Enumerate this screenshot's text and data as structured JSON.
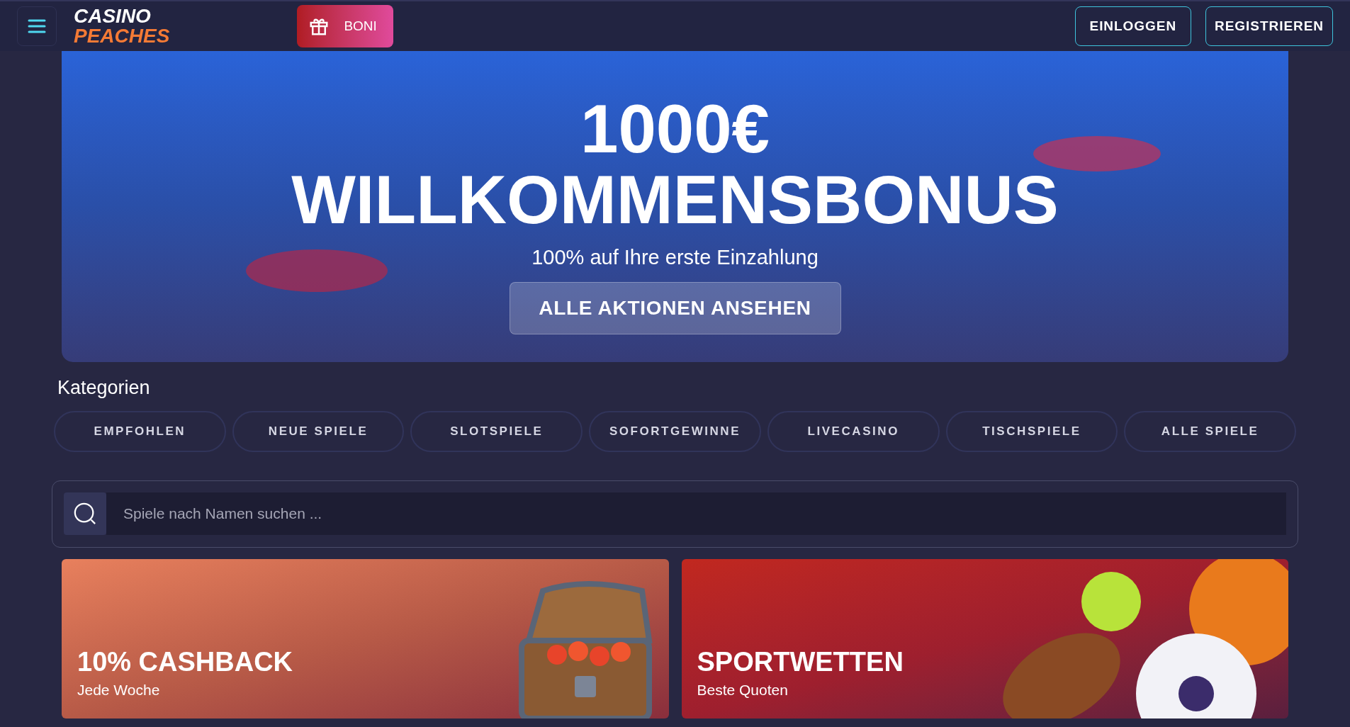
{
  "header": {
    "logo": {
      "line_1": "CASINO",
      "line_2": "PEACHES"
    },
    "bonus_button": "BONI",
    "login_button": "EINLOGGEN",
    "register_button": "REGISTRIEREN"
  },
  "hero": {
    "amount": "1000€",
    "title": "WILLKOMMENSBONUS",
    "subtitle": "100% auf Ihre erste Einzahlung",
    "button": "ALLE AKTIONEN ANSEHEN"
  },
  "categories": {
    "heading": "Kategorien",
    "items": [
      {
        "label": "EMPFOHLEN"
      },
      {
        "label": "NEUE SPIELE"
      },
      {
        "label": "SLOTSPIELE"
      },
      {
        "label": "SOFORTGEWINNE"
      },
      {
        "label": "LIVECASINO"
      },
      {
        "label": "TISCHSPIELE"
      },
      {
        "label": "ALLE SPIELE"
      }
    ]
  },
  "search": {
    "placeholder": "Spiele nach Namen suchen ..."
  },
  "promos": [
    {
      "kind": "cashback",
      "title": "10% CASHBACK",
      "subtitle": "Jede Woche"
    },
    {
      "kind": "sports",
      "title": "SPORTWETTEN",
      "subtitle": "Beste Quoten"
    }
  ]
}
